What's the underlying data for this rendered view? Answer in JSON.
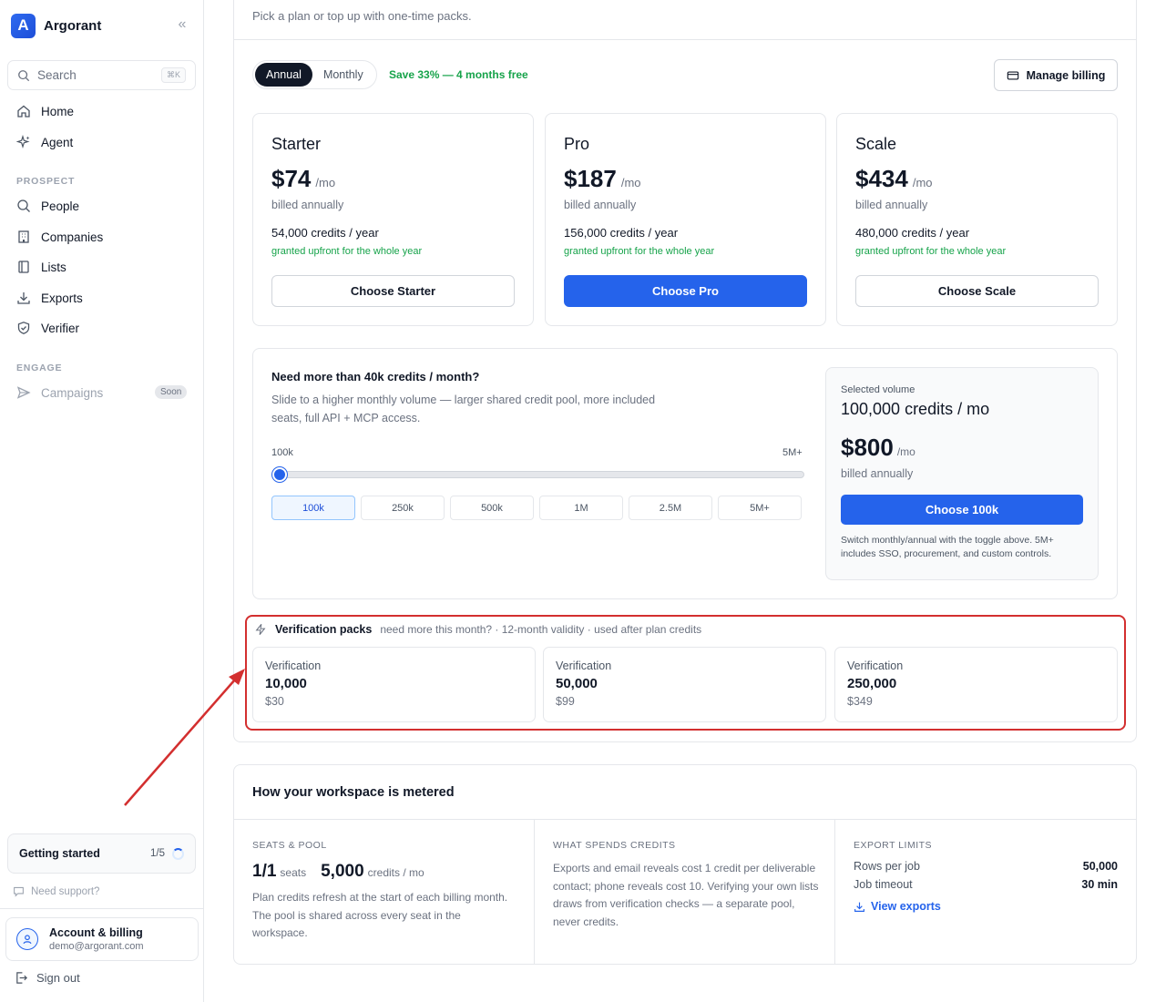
{
  "brand": {
    "name": "Argorant",
    "logo_letter": "A"
  },
  "sidebar": {
    "search_placeholder": "Search",
    "search_shortcut": "⌘K",
    "items": [
      {
        "label": "Home",
        "icon": "home-icon"
      },
      {
        "label": "Agent",
        "icon": "sparkle-icon"
      }
    ],
    "prospect_label": "PROSPECT",
    "prospect_items": [
      {
        "label": "People",
        "icon": "search-icon"
      },
      {
        "label": "Companies",
        "icon": "building-icon"
      },
      {
        "label": "Lists",
        "icon": "book-icon"
      },
      {
        "label": "Exports",
        "icon": "download-icon"
      },
      {
        "label": "Verifier",
        "icon": "shield-icon"
      }
    ],
    "engage_label": "ENGAGE",
    "engage_items": [
      {
        "label": "Campaigns",
        "icon": "send-icon",
        "badge": "Soon"
      }
    ],
    "getting_started": {
      "label": "Getting started",
      "progress": "1/5",
      "progress_fraction": 0.2
    },
    "support": "Need support?",
    "account": {
      "name": "Account & billing",
      "email": "demo@argorant.com"
    },
    "sign_out": "Sign out"
  },
  "billing": {
    "subtitle": "Pick a plan or top up with one-time packs.",
    "toggle": {
      "annual": "Annual",
      "monthly": "Monthly",
      "selected": "Annual"
    },
    "save_note": "Save 33% — 4 months free",
    "manage_billing": "Manage billing",
    "plans": [
      {
        "name": "Starter",
        "price": "$74",
        "per": "/mo",
        "billed": "billed annually",
        "credits": "54,000 credits / year",
        "grant": "granted upfront for the whole year",
        "cta": "Choose Starter"
      },
      {
        "name": "Pro",
        "price": "$187",
        "per": "/mo",
        "billed": "billed annually",
        "credits": "156,000 credits / year",
        "grant": "granted upfront for the whole year",
        "cta": "Choose Pro"
      },
      {
        "name": "Scale",
        "price": "$434",
        "per": "/mo",
        "billed": "billed annually",
        "credits": "480,000 credits / year",
        "grant": "granted upfront for the whole year",
        "cta": "Choose Scale"
      }
    ],
    "volume": {
      "title": "Need more than 40k credits / month?",
      "description": "Slide to a higher monthly volume — larger shared credit pool, more included seats, full API + MCP access.",
      "min_label": "100k",
      "max_label": "5M+",
      "slider_value_fraction": 0,
      "options": [
        "100k",
        "250k",
        "500k",
        "1M",
        "2.5M",
        "5M+"
      ],
      "selected_option": "100k",
      "selected_label": "Selected volume",
      "selected_value": "100,000 credits / mo",
      "price": "$800",
      "per": "/mo",
      "billed": "billed annually",
      "cta": "Choose 100k",
      "note": "Switch monthly/annual with the toggle above. 5M+ includes SSO, procurement, and custom controls."
    },
    "packs": {
      "title": "Verification packs",
      "subtitle": "need more this month? · 12-month validity · used after plan credits",
      "items": [
        {
          "label": "Verification",
          "qty": "10,000",
          "price": "$30"
        },
        {
          "label": "Verification",
          "qty": "50,000",
          "price": "$99"
        },
        {
          "label": "Verification",
          "qty": "250,000",
          "price": "$349"
        }
      ]
    }
  },
  "metering": {
    "title": "How your workspace is metered",
    "seats": {
      "label": "SEATS & POOL",
      "seats_value": "1/1",
      "seats_unit": "seats",
      "credits_value": "5,000",
      "credits_unit": "credits / mo",
      "text": "Plan credits refresh at the start of each billing month. The pool is shared across every seat in the workspace."
    },
    "spend": {
      "label": "WHAT SPENDS CREDITS",
      "text": "Exports and email reveals cost 1 credit per deliverable contact; phone reveals cost 10. Verifying your own lists draws from verification checks — a separate pool, never credits."
    },
    "limits": {
      "label": "EXPORT LIMITS",
      "rows": [
        {
          "label": "Rows per job",
          "value": "50,000"
        },
        {
          "label": "Job timeout",
          "value": "30 min"
        }
      ],
      "link": "View exports"
    }
  },
  "annotation": {
    "color": "#d32f2f"
  }
}
